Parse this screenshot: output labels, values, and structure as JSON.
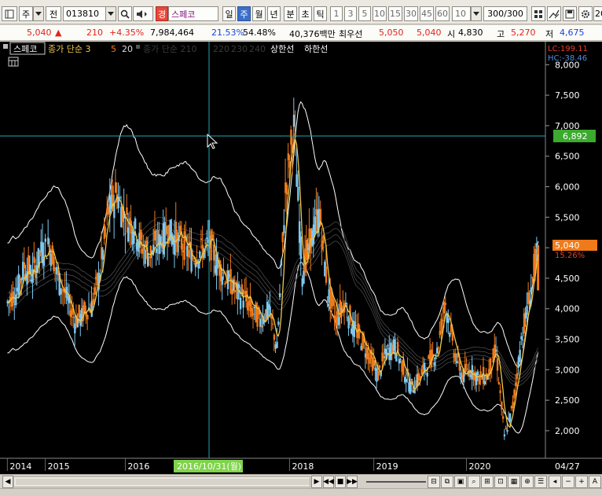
{
  "toolbar": {
    "period_label": "주",
    "code_label": "전",
    "stock_code": "013810",
    "market_badge": "경",
    "stock_name": "스페코",
    "periods": [
      "일",
      "주",
      "월",
      "년"
    ],
    "active_period": "주",
    "minute_tabs": [
      "분",
      "초",
      "틱"
    ],
    "numbers": [
      "1",
      "3",
      "5",
      "10",
      "15",
      "30",
      "45",
      "60"
    ],
    "count_select": "10",
    "count_display": "300/300",
    "right_cut": "20"
  },
  "quote": {
    "price": "5,040",
    "arrow": "▲",
    "change": "210",
    "change_pct": "+4.35%",
    "volume": "7,984,464",
    "pct1": "21.53%",
    "pct2": "54.48%",
    "amount": "40,376백만",
    "priority_label": "최우선",
    "ask": "5,050",
    "bid": "5,040",
    "open_label": "시",
    "open": "4,830",
    "high_label": "고",
    "high": "5,270",
    "low_label": "저",
    "low": "4,675"
  },
  "legend": {
    "stock": "스페코",
    "ma_price": "종가 단순 3",
    "ma_values": [
      "5",
      "20"
    ],
    "ma_dim": "종가 단순 210",
    "ma_dim_values": [
      "220",
      "230",
      "240"
    ],
    "limit_up": "상한선",
    "limit_down": "하한선"
  },
  "overlay": {
    "lc_label": "LC:199.11",
    "hc_label": "HC:-38.46",
    "crosshair_value": "6,892",
    "current_price": "5,040",
    "current_pct": "15.26%",
    "crosshair_date": "2016/10/31(월)",
    "right_axis_date": "04/27"
  },
  "colors": {
    "up": "#f07a1a",
    "down": "#7ec8f0",
    "ma": "#f0c848",
    "envelope": "#ffffff",
    "crosshair": "#1fa6b8",
    "price_box": "#f07a1a",
    "cross_box": "#3caa2e"
  },
  "chart_data": {
    "type": "candlestick",
    "y_axis": {
      "ticks": [
        "8,000",
        "7,500",
        "7,000",
        "6,500",
        "6,000",
        "5,500",
        "5,000",
        "4,500",
        "4,000",
        "3,500",
        "3,000",
        "2,500",
        "2,000"
      ],
      "ylim": [
        1600,
        8300
      ]
    },
    "x_axis": {
      "ticks": [
        "2014",
        "2015",
        "2016",
        "2018",
        "2019",
        "2020"
      ]
    },
    "series": [
      {
        "x": [
          2014.0,
          2014.1,
          2014.2,
          2014.3,
          2014.4,
          2014.5,
          2014.6,
          2014.7,
          2014.8,
          2014.9,
          2015.0,
          2015.1,
          2015.2,
          2015.3,
          2015.4,
          2015.5,
          2015.6,
          2015.7,
          2015.8,
          2015.9,
          2016.0,
          2016.1,
          2016.2,
          2016.3,
          2016.4,
          2016.5,
          2016.6,
          2016.7,
          2016.8,
          2016.9,
          2017.0,
          2017.1,
          2017.2,
          2017.3,
          2017.4,
          2017.5,
          2017.6,
          2017.7,
          2017.8,
          2017.9,
          2018.0,
          2018.1,
          2018.2,
          2018.3,
          2018.4,
          2018.5,
          2018.6,
          2018.7,
          2018.8,
          2018.9,
          2019.0,
          2019.1,
          2019.2,
          2019.3,
          2019.4,
          2019.5,
          2019.6,
          2019.7,
          2019.8,
          2019.9,
          2020.0,
          2020.1,
          2020.2,
          2020.3
        ],
        "y": [
          4100,
          4250,
          4700,
          4550,
          4950,
          5050,
          4500,
          4200,
          3800,
          3900,
          4050,
          4600,
          5600,
          5900,
          5450,
          5350,
          5000,
          4900,
          5100,
          5300,
          5150,
          5000,
          4850,
          4950,
          5050,
          4700,
          4500,
          4300,
          4200,
          3950,
          3800,
          4000,
          3350,
          5900,
          7000,
          4600,
          5100,
          5600,
          4300,
          3800,
          4100,
          3700,
          3500,
          3200,
          2900,
          3300,
          3400,
          3000,
          2700,
          2900,
          3100,
          3300,
          4100,
          3300,
          2900,
          3000,
          2850,
          2900,
          3300,
          1900,
          2400,
          3500,
          4200,
          5040
        ],
        "name": "스페코"
      }
    ]
  }
}
